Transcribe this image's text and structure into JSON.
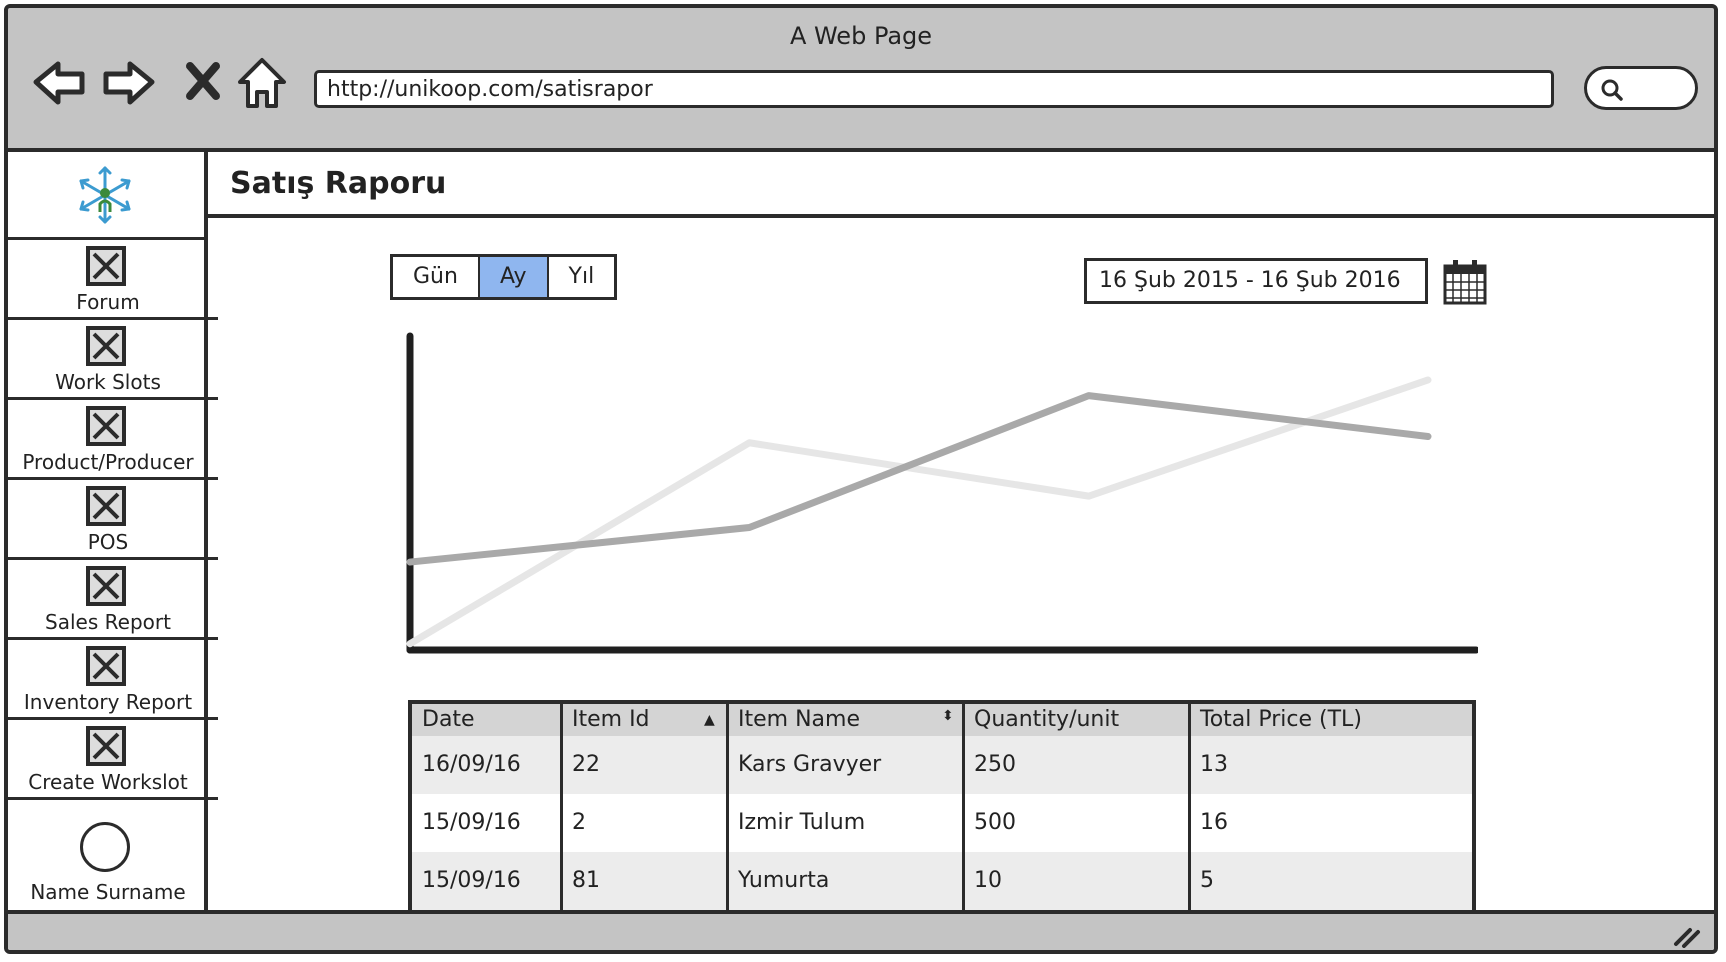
{
  "browser": {
    "title": "A Web Page",
    "url": "http://unikoop.com/satisrapor"
  },
  "icons": {
    "back": "arrow-left-icon",
    "forward": "arrow-right-icon",
    "stop": "close-icon",
    "home": "home-icon",
    "search": "search-icon",
    "calendar": "calendar-icon",
    "logo": "snowflake-logo",
    "placeholder": "image-placeholder-icon",
    "avatar": "avatar-circle",
    "resize": "resize-grip-icon"
  },
  "sidebar": {
    "items": [
      {
        "label": "Forum"
      },
      {
        "label": "Work Slots"
      },
      {
        "label": "Product/Producer"
      },
      {
        "label": "POS"
      },
      {
        "label": "Sales Report"
      },
      {
        "label": "Inventory Report"
      },
      {
        "label": "Create Workslot"
      }
    ],
    "user": {
      "label": "Name Surname"
    }
  },
  "page": {
    "title": "Satış Raporu"
  },
  "period_toggle": {
    "options": [
      "Gün",
      "Ay",
      "Yıl"
    ],
    "selected": "Ay"
  },
  "date_range": "16 Şub 2015 - 16 Şub 2016",
  "colors": {
    "selected": "#8fb6ef",
    "series_dark": "#a9a9a9",
    "series_light": "#e6e6e6",
    "header_bg": "#d4d4d4",
    "row_alt": "#ececec"
  },
  "chart_data": {
    "type": "line",
    "title": "",
    "xlabel": "",
    "ylabel": "",
    "x": [
      0,
      1,
      2,
      3
    ],
    "xlim": [
      0,
      3
    ],
    "ylim": [
      0,
      100
    ],
    "series": [
      {
        "values": [
          28,
          39,
          81,
          68
        ],
        "color": "#a9a9a9"
      },
      {
        "values": [
          2,
          66,
          49,
          86
        ],
        "color": "#e6e6e6"
      }
    ]
  },
  "table": {
    "columns": [
      "Date",
      "Item Id",
      "Item Name",
      "Quantity/unit",
      "Total Price  (TL)"
    ],
    "rows": [
      [
        "16/09/16",
        "22",
        "Kars Gravyer",
        "250",
        "13"
      ],
      [
        "15/09/16",
        "2",
        "Izmir Tulum",
        "500",
        "16"
      ],
      [
        "15/09/16",
        "81",
        "Yumurta",
        "10",
        "5"
      ]
    ]
  }
}
